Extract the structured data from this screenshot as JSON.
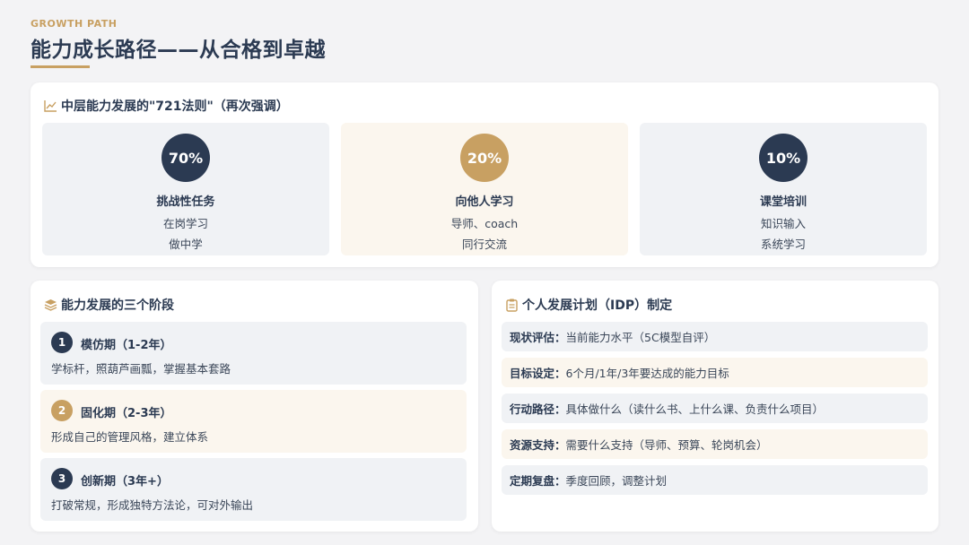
{
  "header": {
    "eyebrow": "GROWTH PATH",
    "title": "能力成长路径——从合格到卓越"
  },
  "rule_721": {
    "heading": "中层能力发展的\"721法则\"（再次强调）",
    "icon": "line-chart-icon",
    "tiles": [
      {
        "percent": "70%",
        "title": "挑战性任务",
        "line1": "在岗学习",
        "line2": "做中学",
        "theme": "navy"
      },
      {
        "percent": "20%",
        "title": "向他人学习",
        "line1": "导师、coach",
        "line2": "同行交流",
        "theme": "gold"
      },
      {
        "percent": "10%",
        "title": "课堂培训",
        "line1": "知识输入",
        "line2": "系统学习",
        "theme": "navy"
      }
    ]
  },
  "stages": {
    "heading": "能力发展的三个阶段",
    "icon": "layers-icon",
    "items": [
      {
        "num": "1",
        "title": "模仿期（1-2年）",
        "desc": "学标杆，照葫芦画瓢，掌握基本套路"
      },
      {
        "num": "2",
        "title": "固化期（2-3年）",
        "desc": "形成自己的管理风格，建立体系"
      },
      {
        "num": "3",
        "title": "创新期（3年+）",
        "desc": "打破常规，形成独特方法论，可对外输出"
      }
    ]
  },
  "idp": {
    "heading": "个人发展计划（IDP）制定",
    "icon": "clipboard-icon",
    "rows": [
      {
        "key": "现状评估：",
        "value": "当前能力水平（5C模型自评）"
      },
      {
        "key": "目标设定：",
        "value": "6个月/1年/3年要达成的能力目标"
      },
      {
        "key": "行动路径：",
        "value": "具体做什么（读什么书、上什么课、负责什么项目）"
      },
      {
        "key": "资源支持：",
        "value": "需要什么支持（导师、预算、轮岗机会）"
      },
      {
        "key": "定期复盘：",
        "value": "季度回顾，调整计划"
      }
    ]
  },
  "colors": {
    "navy": "#2b3a52",
    "gold": "#c8a062",
    "navy_tint": "#f0f2f5",
    "gold_tint": "#fbf6ee"
  }
}
